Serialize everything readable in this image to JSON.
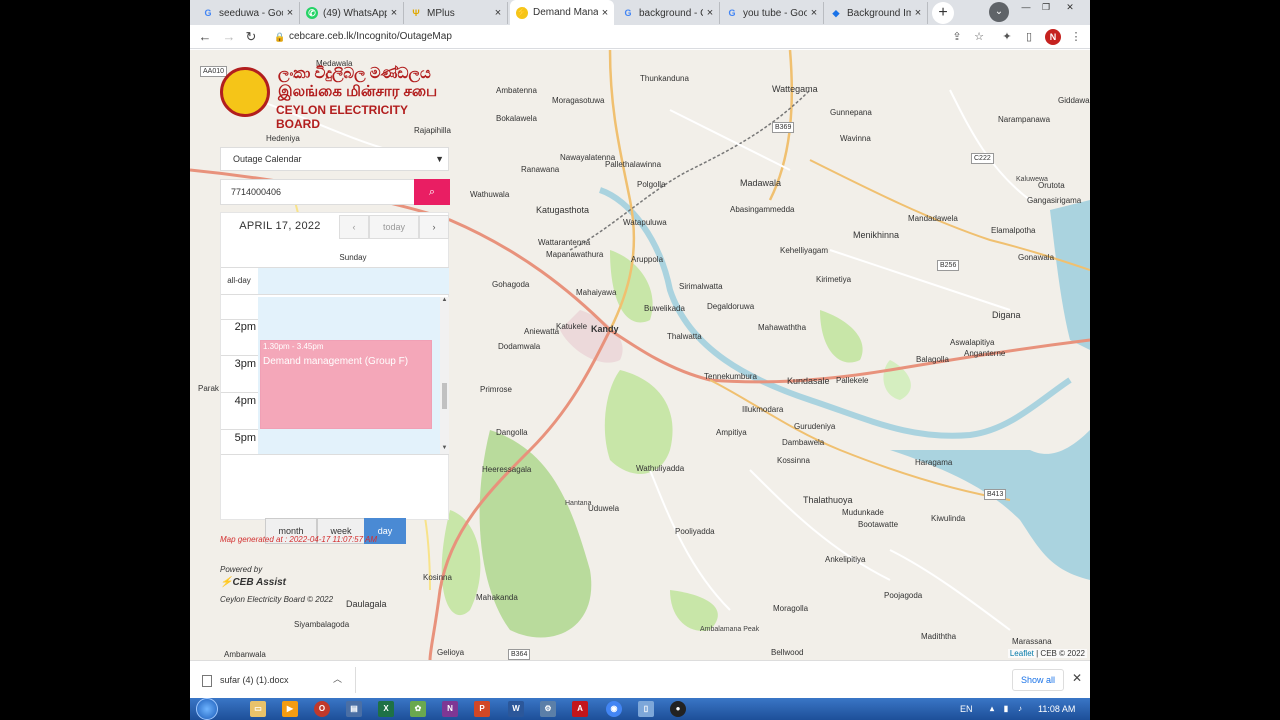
{
  "browser": {
    "tabs": [
      {
        "title": "seeduwa - Goo",
        "icon": "G",
        "icon_color": "#4285f4"
      },
      {
        "title": "(49) WhatsApp",
        "icon": "W",
        "icon_color": "#25d366"
      },
      {
        "title": "MPlus",
        "icon": "M",
        "icon_color": "#e0a800"
      },
      {
        "title": "Demand Manag",
        "icon": "C",
        "icon_color": "#f5c518"
      },
      {
        "title": "background - G",
        "icon": "G",
        "icon_color": "#4285f4"
      },
      {
        "title": "you tube - Goo",
        "icon": "G",
        "icon_color": "#4285f4"
      },
      {
        "title": "Background Im",
        "icon": "B",
        "icon_color": "#1a73e8"
      }
    ],
    "url": "cebcare.ceb.lk/Incognito/OutageMap",
    "profile_initial": "N"
  },
  "logo": {
    "line1": "ලංකා විදුලිබල මණ්ඩලය",
    "line2": "இலங்கை மின்சார சபை",
    "line3": "CEYLON ELECTRICITY BOARD"
  },
  "panel": {
    "select_value": "Outage Calendar",
    "account_number": "7714000406",
    "calendar": {
      "date": "APRIL 17, 2022",
      "today_label": "today",
      "day_name": "Sunday",
      "allday_label": "all-day",
      "hours": [
        "2pm",
        "3pm",
        "4pm",
        "5pm"
      ],
      "event_time": "1.30pm - 3.45pm",
      "event_title": "Demand management (Group F)",
      "views": [
        "month",
        "week",
        "day"
      ],
      "active_view": "day"
    },
    "map_generated": "Map generated at : 2022-04-17 11:07:57 AM",
    "powered_by": "Powered by",
    "ceb_assist": "CEB Assist",
    "copyright": "Ceylon Electricity Board © 2022"
  },
  "map": {
    "labels": [
      "Medawala",
      "Thunkanduna",
      "Wattegama",
      "Ambatenna",
      "Moragasotuwa",
      "Bokalawela",
      "Hedeniya",
      "Rajapihilla",
      "Pallethalawinna",
      "Nawayalatenna",
      "Ranawana",
      "Polgolla",
      "Madawala",
      "Katugasthota",
      "Wathuwala",
      "Abasingammedda",
      "Menikhinna",
      "Watapuluwa",
      "Kehelliyagam",
      "Wattarantenna",
      "Mapanawathura",
      "Aruppola",
      "Kirimetiya",
      "Gohagoda",
      "Sirimalwatta",
      "Mahaiyawa",
      "Buwelikada",
      "Degaldoruwa",
      "Mahawaththa",
      "Kandy",
      "Aniewatta",
      "Katukele",
      "Thalwatta",
      "Dodamwala",
      "Kundasale",
      "Pallekele",
      "Tennekumbura",
      "Balagolla",
      "Digana",
      "Primrose",
      "Illukmodara",
      "Dangolla",
      "Ampitiya",
      "Gurudeniya",
      "Dambawela",
      "Heeressagala",
      "Wathuliyadda",
      "Kossinna",
      "Haragama",
      "Thalathuoya",
      "Hantana",
      "Uduwela",
      "Pooliyadda",
      "Mudunkade",
      "Bootawatte",
      "Ankelipitiya",
      "Kiwulinda",
      "Poojagoda",
      "Moragolla",
      "Madiththa",
      "Daulagala",
      "Kosinna",
      "Mahakanda",
      "Ambalamana Peak",
      "Siyambalagoda",
      "Ambanwala",
      "Gelioya",
      "Bellwood",
      "Marassana",
      "Narampanawa",
      "Giddawa",
      "Gangasirigama",
      "Mandadawela",
      "Elamalpotha",
      "Gonawala",
      "Anganterne",
      "Aswalapitiya",
      "Kaluwewa",
      "Orutota",
      "Parak",
      "Wavinna",
      "Gunnepana"
    ],
    "shields": [
      "AA010",
      "B369",
      "C222",
      "B256",
      "B413",
      "B364"
    ],
    "attribution_leaflet": "Leaflet",
    "attribution_ceb": "| CEB © 2022"
  },
  "downloads": {
    "file": "sufar (4) (1).docx",
    "show_all": "Show all"
  },
  "taskbar": {
    "language": "EN",
    "time": "11:08 AM"
  }
}
